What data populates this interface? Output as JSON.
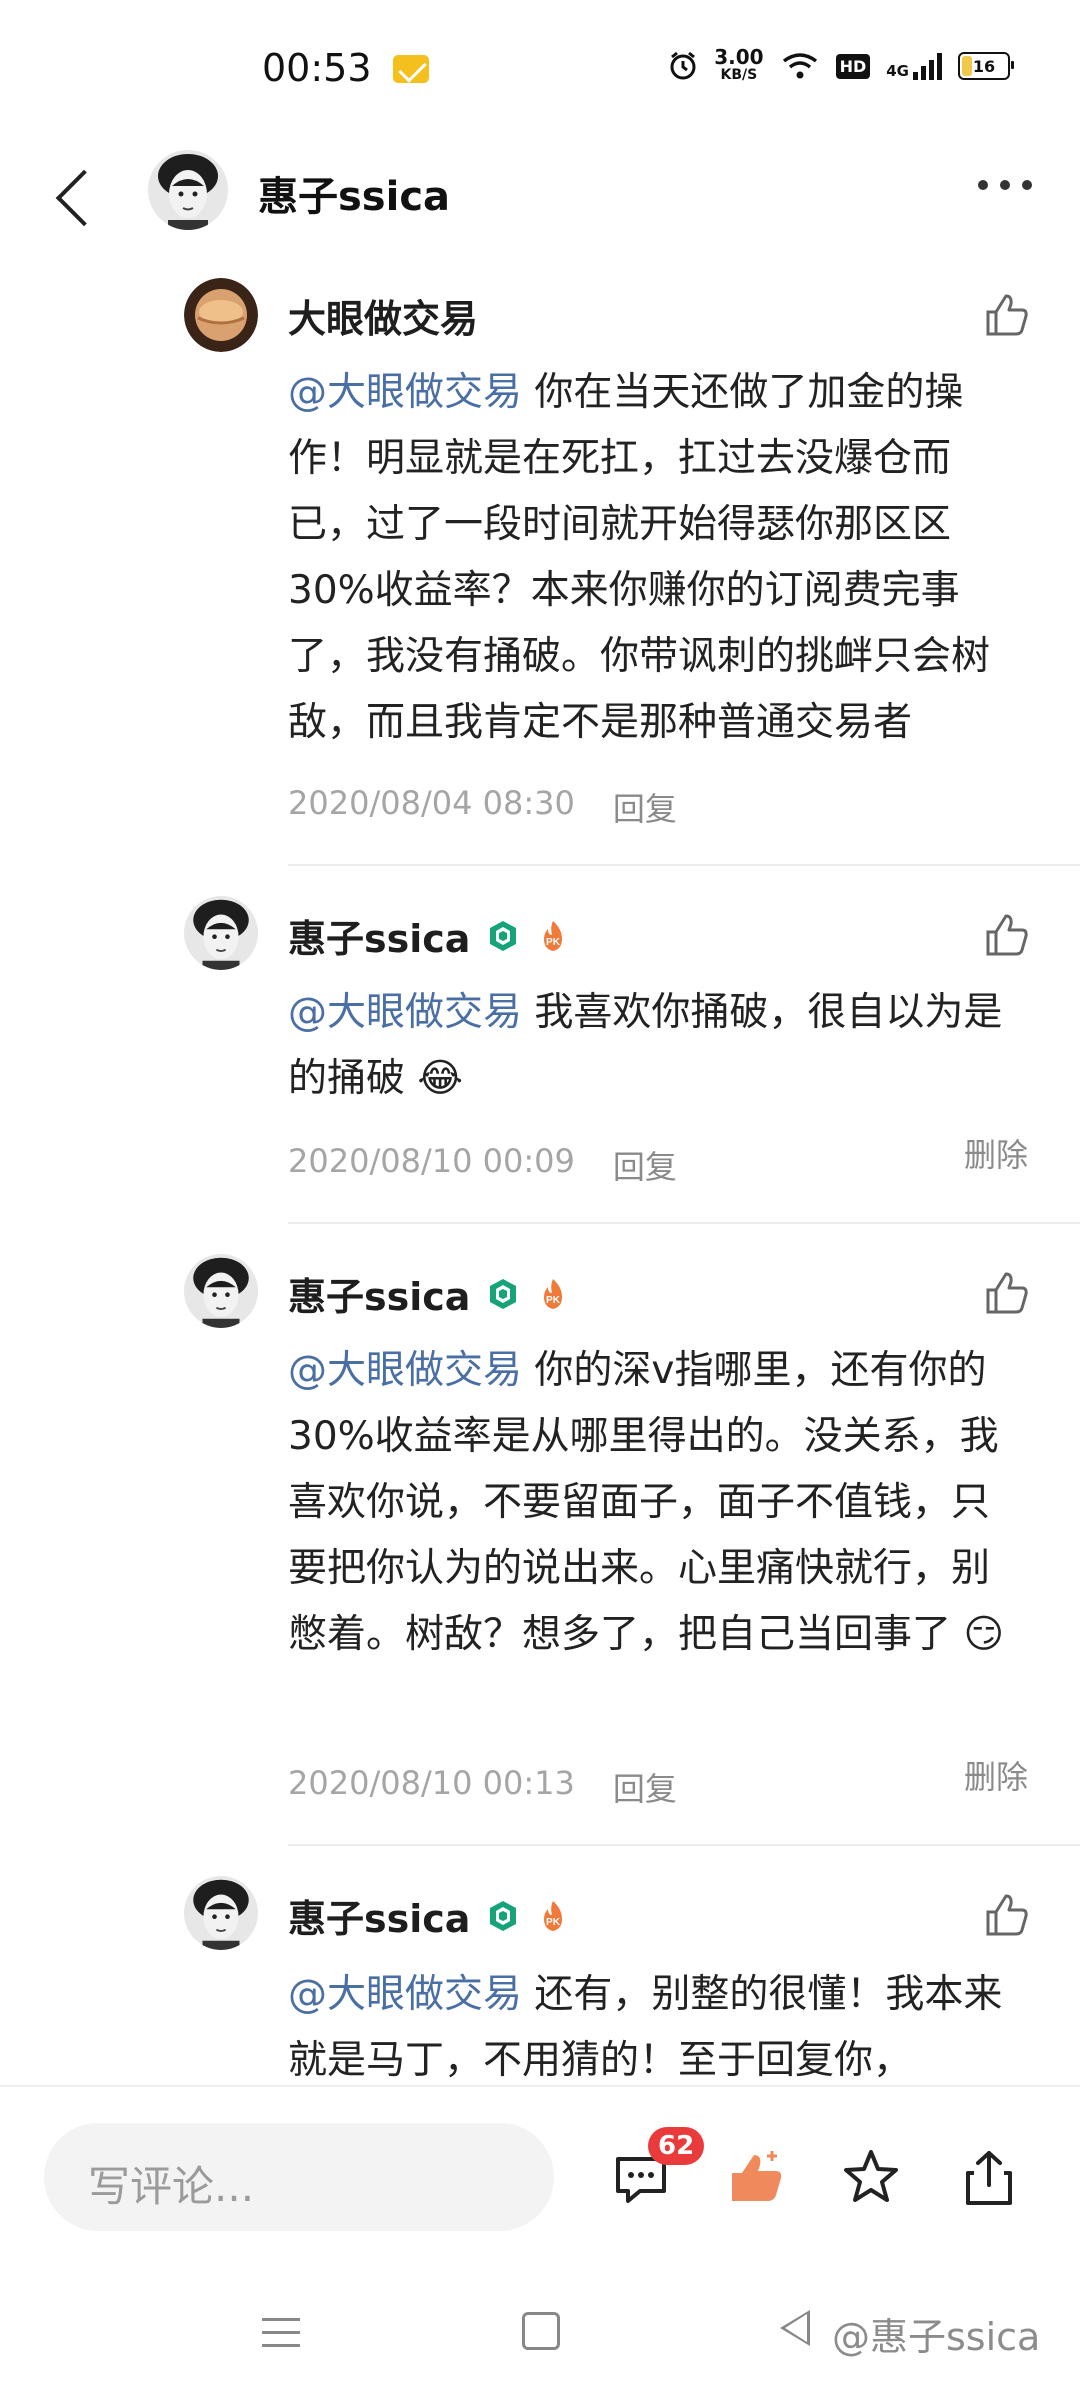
{
  "status_bar": {
    "time": "00:53",
    "speed_value": "3.00",
    "speed_unit": "KB/S",
    "hd": "HD",
    "network": "4G",
    "battery": "16"
  },
  "header": {
    "title": "惠子ssica"
  },
  "comments": [
    {
      "author": "大眼做交易",
      "mention": "@大眼做交易",
      "text": " 你在当天还做了加金的操作！明显就是在死扛，扛过去没爆仓而已，过了一段时间就开始得瑟你那区区30%收益率？本来你赚你的订阅费完事了，我没有捅破。你带讽刺的挑衅只会树敌，而且我肯定不是那种普通交易者",
      "timestamp": "2020/08/04 08:30",
      "reply": "回复"
    },
    {
      "author": "惠子ssica",
      "mention": "@大眼做交易",
      "text": " 我喜欢你捅破，很自以为是的捅破 😂",
      "timestamp": "2020/08/10 00:09",
      "reply": "回复",
      "delete": "删除"
    },
    {
      "author": "惠子ssica",
      "mention": "@大眼做交易",
      "text": " 你的深v指哪里，还有你的30%收益率是从哪里得出的。没关系，我喜欢你说，不要留面子，面子不值钱，只要把你认为的说出来。心里痛快就行，别憋着。树敌？想多了，把自己当回事了 😏",
      "timestamp": "2020/08/10 00:13",
      "reply": "回复",
      "delete": "删除"
    },
    {
      "author": "惠子ssica",
      "mention": "@大眼做交易",
      "text": " 还有，别整的很懂！我本来就是马丁，不用猜的！至于回复你，"
    }
  ],
  "bottom_bar": {
    "placeholder": "写评论...",
    "comment_count": "62"
  },
  "watermark": "@惠子ssica",
  "colors": {
    "mention": "#4a6fa5",
    "badge_red": "#e93b3b",
    "like_orange": "#f08a5d",
    "level_green": "#17a37a"
  },
  "icons": [
    "back-icon",
    "more-icon",
    "thumbs-up-icon",
    "comment-icon",
    "like-icon",
    "star-icon",
    "share-icon",
    "level-badge-icon",
    "pk-badge-icon"
  ]
}
